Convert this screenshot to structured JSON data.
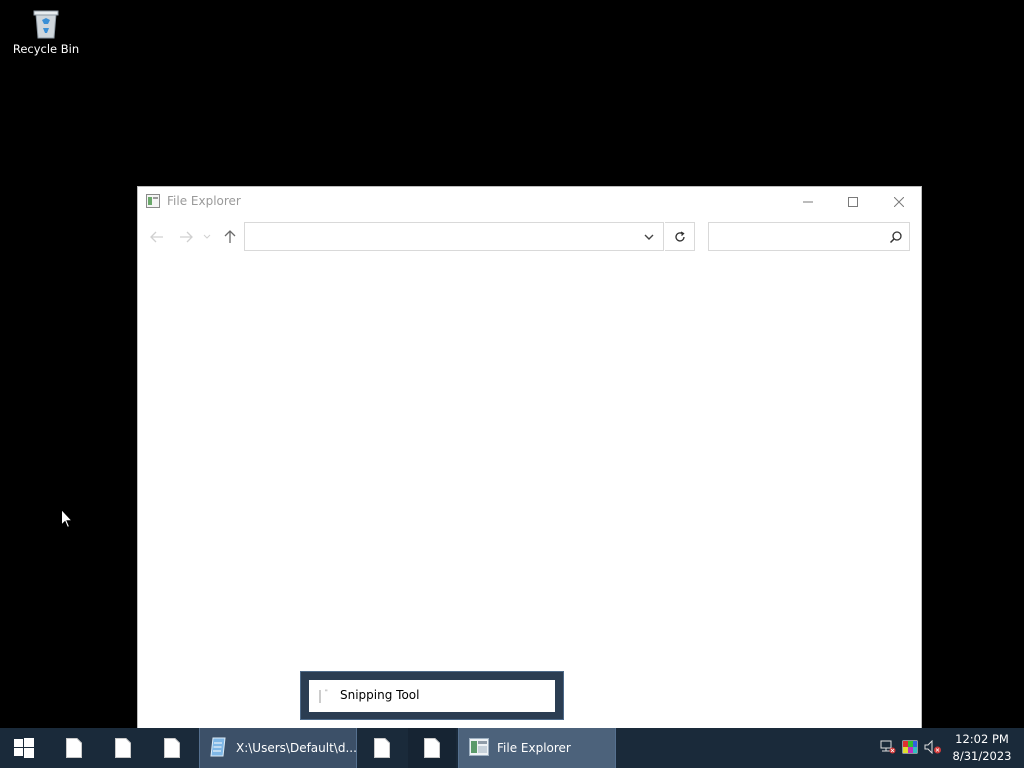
{
  "desktop": {
    "icons": [
      {
        "label": "Recycle Bin",
        "icon": "recycle-bin-icon"
      }
    ]
  },
  "window": {
    "title": "File Explorer",
    "address": {
      "value": "",
      "placeholder": ""
    },
    "search": {
      "value": "",
      "placeholder": ""
    }
  },
  "thumbnail_popup": {
    "label": "Snipping Tool"
  },
  "taskbar": {
    "items": [
      {
        "label": "X:\\Users\\Default\\d...",
        "icon": "notepad-icon"
      },
      {
        "label": "File Explorer",
        "icon": "file-explorer-icon"
      }
    ],
    "clock": {
      "time": "12:02 PM",
      "date": "8/31/2023"
    }
  },
  "colors": {
    "desktop": "#000000",
    "taskbar": "#1a2a3a",
    "taskbar_button": "#3c5068",
    "popup_border": "#2b3d52"
  }
}
